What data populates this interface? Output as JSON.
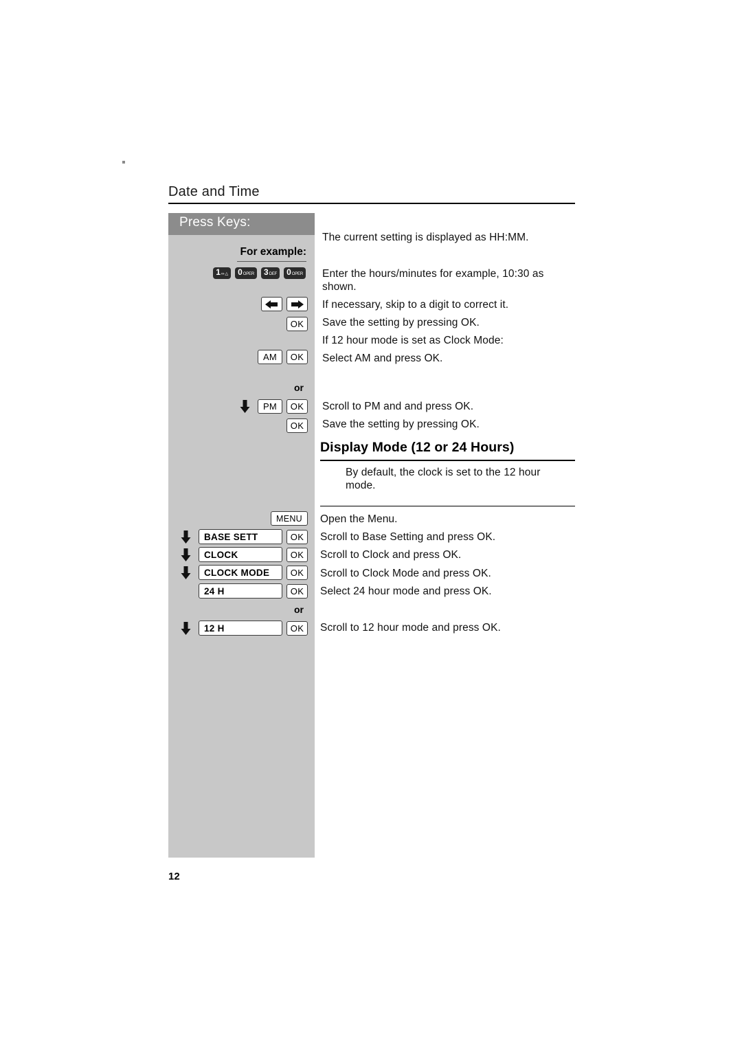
{
  "document": {
    "header_title": "Date and Time",
    "page_number": "12"
  },
  "keys_panel": {
    "title": "Press Keys:",
    "for_example_label": "For example:",
    "or_label_1": "or",
    "or_label_2": "or",
    "numeric_keys": [
      {
        "digit": "1",
        "sup": "∞∙△"
      },
      {
        "digit": "0",
        "sup": "OPER"
      },
      {
        "digit": "3",
        "sup": "DEF"
      },
      {
        "digit": "0",
        "sup": "OPER"
      }
    ],
    "arrow_left_icon": "arrow-left-icon",
    "arrow_right_icon": "arrow-right-icon",
    "ok_label": "OK",
    "am_label": "AM",
    "pm_label": "PM",
    "menu_label": "MENU",
    "menu_items": [
      {
        "label": "BASE SETT",
        "ok": "OK"
      },
      {
        "label": "CLOCK",
        "ok": "OK"
      },
      {
        "label": "CLOCK MODE",
        "ok": "OK"
      },
      {
        "label": "24 H",
        "ok": "OK"
      },
      {
        "label": "12 H",
        "ok": "OK"
      }
    ]
  },
  "instructions": {
    "line_current_setting": "The current setting is displayed as HH:MM.",
    "line_enter_hours_1": "Enter the hours/minutes for example, 10:30 as",
    "line_enter_hours_2": "shown.",
    "line_skip_digit": "If necessary, skip to a digit to correct it.",
    "line_save_ok_1": "Save the setting by pressing OK.",
    "line_12h_mode": "If 12 hour mode is set as Clock Mode:",
    "line_select_am": "Select AM and press OK.",
    "line_scroll_pm": "Scroll to PM and and press OK.",
    "line_save_ok_2": "Save the setting by pressing OK.",
    "line_open_menu": "Open the Menu.",
    "line_scroll_base": "Scroll to Base Setting and press OK.",
    "line_scroll_clock": "Scroll to Clock and press OK.",
    "line_scroll_clock_mode": "Scroll to Clock Mode and press OK.",
    "line_select_24h": "Select 24 hour mode and press OK.",
    "line_scroll_12h": "Scroll to 12 hour mode and press OK."
  },
  "display_mode_section": {
    "heading": "Display Mode (12 or 24 Hours)",
    "body_line_1": "By default, the clock is set to the 12 hour",
    "body_line_2": "mode."
  }
}
